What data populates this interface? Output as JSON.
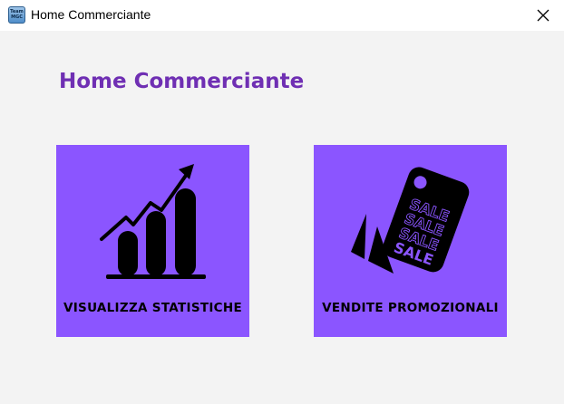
{
  "window": {
    "title": "Home Commerciante",
    "icon_text_line1": "Team",
    "icon_text_line2": "MGC",
    "close_glyph": "✕"
  },
  "main": {
    "heading": "Home Commerciante",
    "cards": [
      {
        "label": "VISUALIZZA STATISTICHE",
        "icon": "bar-chart-growth-icon"
      },
      {
        "label": "VENDITE PROMOZIONALI",
        "icon": "sale-tag-icon"
      }
    ],
    "sale_tag_words": [
      "SALE",
      "SALE",
      "SALE",
      "SALE"
    ]
  },
  "colors": {
    "card_background": "#8b55ff",
    "heading": "#6f2fb3",
    "window_background": "#f3f3f3"
  }
}
